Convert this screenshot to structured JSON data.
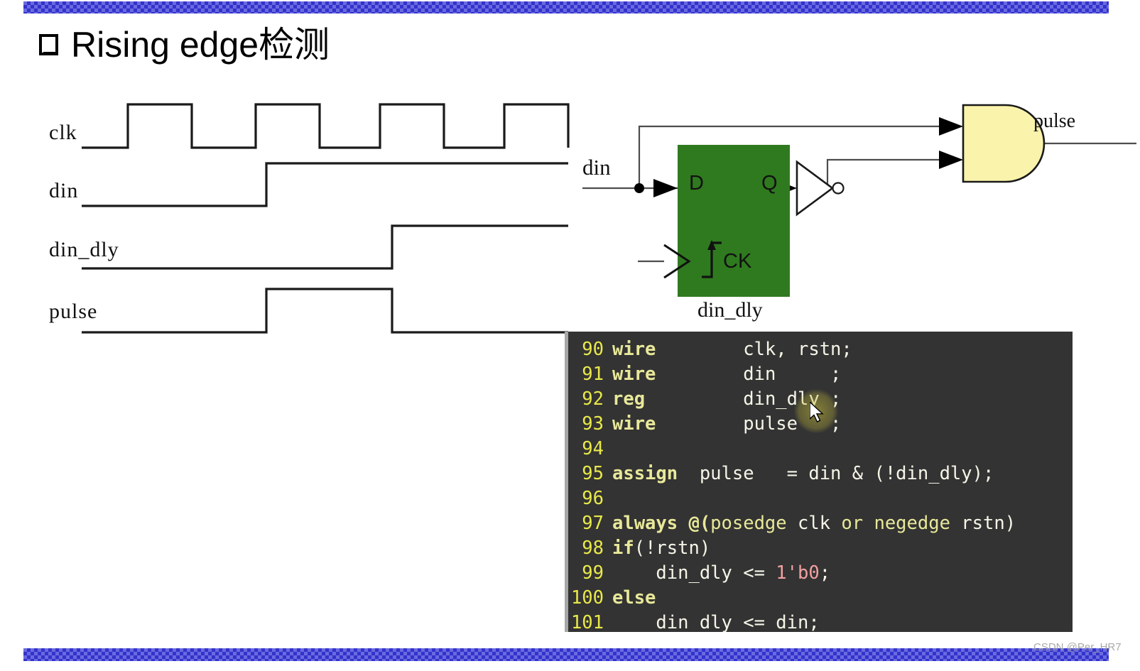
{
  "slide": {
    "title": "Rising edge检测",
    "bullet_icon": "empty-square-bullet-icon",
    "watermark": "CSDN @Per_HR7",
    "top_bar_color": "#3333cc",
    "bottom_bar_color": "#3333cc"
  },
  "timing_diagram": {
    "signals": [
      {
        "name": "clk",
        "label": "clk"
      },
      {
        "name": "din",
        "label": "din"
      },
      {
        "name": "din_dly",
        "label": "din_dly"
      },
      {
        "name": "pulse",
        "label": "pulse"
      }
    ]
  },
  "circuit": {
    "input_label": "din",
    "output_label": "pulse",
    "flipflop": {
      "instance_label": "din_dly",
      "d_pin": "D",
      "q_pin": "Q",
      "clk_pin": "CK",
      "fill_color": "#2f7a1f"
    },
    "and_gate": {
      "fill_color": "#faf3ac"
    },
    "inverter": {
      "fill_color": "#ffffff"
    }
  },
  "code": {
    "background": "#333333",
    "gutter_color": "#e8e84a",
    "lines": [
      {
        "no": "90",
        "segments": [
          {
            "t": "wire",
            "c": "kw"
          },
          {
            "t": "        clk, rstn;",
            "c": "ct"
          }
        ]
      },
      {
        "no": "91",
        "segments": [
          {
            "t": "wire",
            "c": "kw"
          },
          {
            "t": "        din     ;",
            "c": "ct"
          }
        ]
      },
      {
        "no": "92",
        "segments": [
          {
            "t": "reg",
            "c": "kw"
          },
          {
            "t": "         din_dly ;",
            "c": "ct"
          }
        ]
      },
      {
        "no": "93",
        "segments": [
          {
            "t": "wire",
            "c": "kw"
          },
          {
            "t": "        pulse   ;",
            "c": "ct"
          }
        ]
      },
      {
        "no": "94",
        "segments": [
          {
            "t": "",
            "c": "ct"
          }
        ]
      },
      {
        "no": "95",
        "segments": [
          {
            "t": "assign",
            "c": "kw"
          },
          {
            "t": "  pulse   = din & (!din_dly);",
            "c": "ct"
          }
        ]
      },
      {
        "no": "96",
        "segments": [
          {
            "t": "",
            "c": "ct"
          }
        ]
      },
      {
        "no": "97",
        "segments": [
          {
            "t": "always @(",
            "c": "kw"
          },
          {
            "t": "posedge",
            "c": "kw2"
          },
          {
            "t": " clk ",
            "c": "ct"
          },
          {
            "t": "or negedge",
            "c": "kw2"
          },
          {
            "t": " rstn)",
            "c": "ct"
          }
        ]
      },
      {
        "no": "98",
        "segments": [
          {
            "t": "if",
            "c": "kw"
          },
          {
            "t": "(!rstn)",
            "c": "ct"
          }
        ]
      },
      {
        "no": "99",
        "segments": [
          {
            "t": "    din_dly <= ",
            "c": "ct"
          },
          {
            "t": "1'b0",
            "c": "num"
          },
          {
            "t": ";",
            "c": "ct"
          }
        ]
      },
      {
        "no": "100",
        "segments": [
          {
            "t": "else",
            "c": "kw"
          }
        ]
      },
      {
        "no": "101",
        "segments": [
          {
            "t": "    din_dly <= din;",
            "c": "ct"
          }
        ]
      }
    ]
  }
}
